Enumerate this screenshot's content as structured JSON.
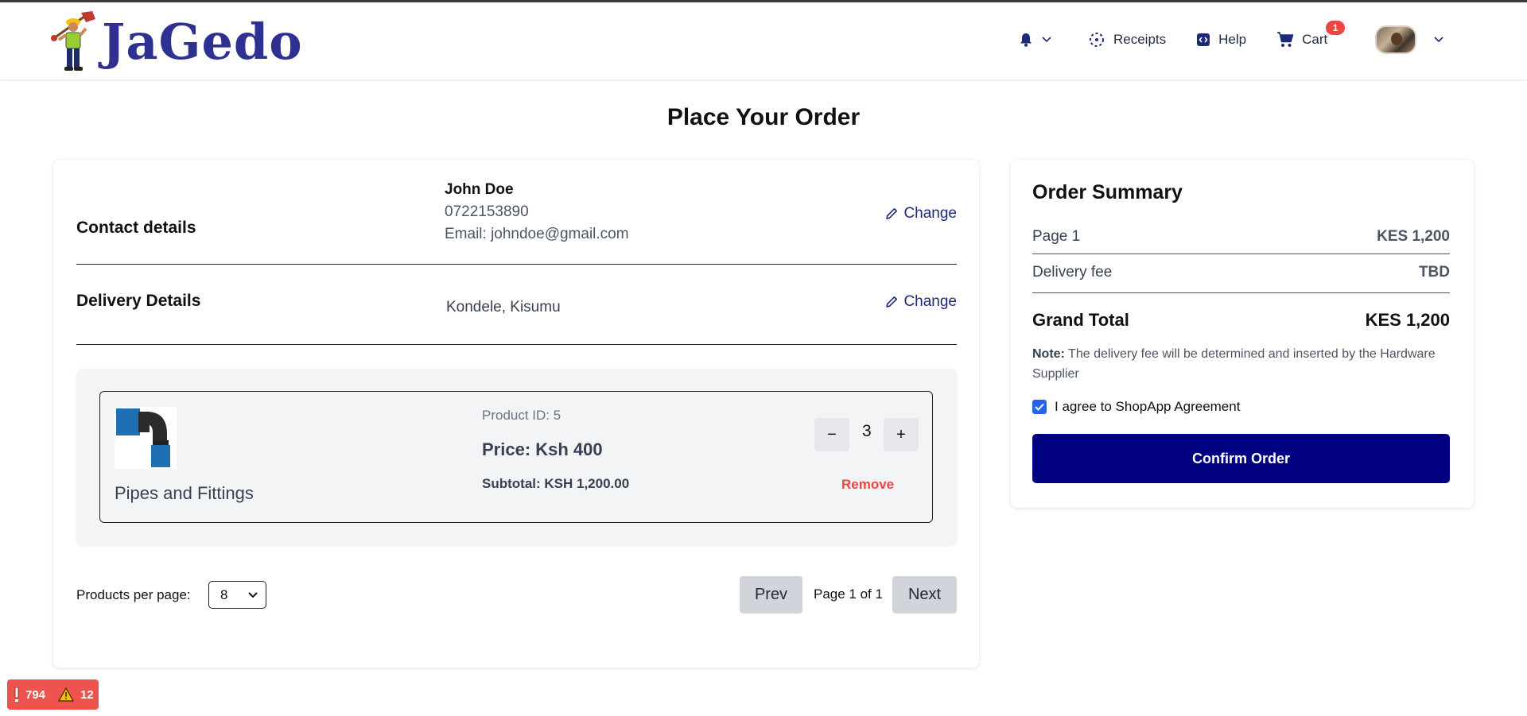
{
  "header": {
    "logo_text": "JaGedo",
    "nav": {
      "receipts": "Receipts",
      "help": "Help",
      "cart": "Cart",
      "cart_count": "1"
    }
  },
  "page": {
    "title": "Place Your Order"
  },
  "contact": {
    "label": "Contact details",
    "name": "John Doe",
    "phone": "0722153890",
    "email": "Email: johndoe@gmail.com",
    "change": "Change"
  },
  "delivery": {
    "label": "Delivery Details",
    "address": "Kondele, Kisumu",
    "change": "Change"
  },
  "product": {
    "name": "Pipes and Fittings",
    "id_text": "Product ID: 5",
    "price_text": "Price: Ksh 400",
    "subtotal_text": "Subtotal: KSH 1,200.00",
    "quantity": "3",
    "minus": "−",
    "plus": "+",
    "remove": "Remove"
  },
  "pagination": {
    "per_page_label": "Products per page:",
    "per_page_value": "8",
    "prev": "Prev",
    "page_info": "Page 1 of 1",
    "next": "Next"
  },
  "summary": {
    "title": "Order Summary",
    "rows": [
      {
        "label": "Page 1",
        "value": "KES 1,200"
      },
      {
        "label": "Delivery fee",
        "value": "TBD"
      }
    ],
    "grand_label": "Grand Total",
    "grand_value": "KES 1,200",
    "note_label": "Note:",
    "note_text": " The delivery fee will be determined and inserted by the Hardware Supplier",
    "agree_text": "I agree to ShopApp Agreement",
    "agree_checked": true,
    "confirm": "Confirm Order"
  },
  "dev_badge": {
    "errors": "794",
    "warnings": "12"
  },
  "colors": {
    "brand": "#2e3192",
    "confirm_button": "#000080",
    "remove": "#ef4444",
    "cart_badge": "#ef4444",
    "link": "#1e2a78"
  }
}
